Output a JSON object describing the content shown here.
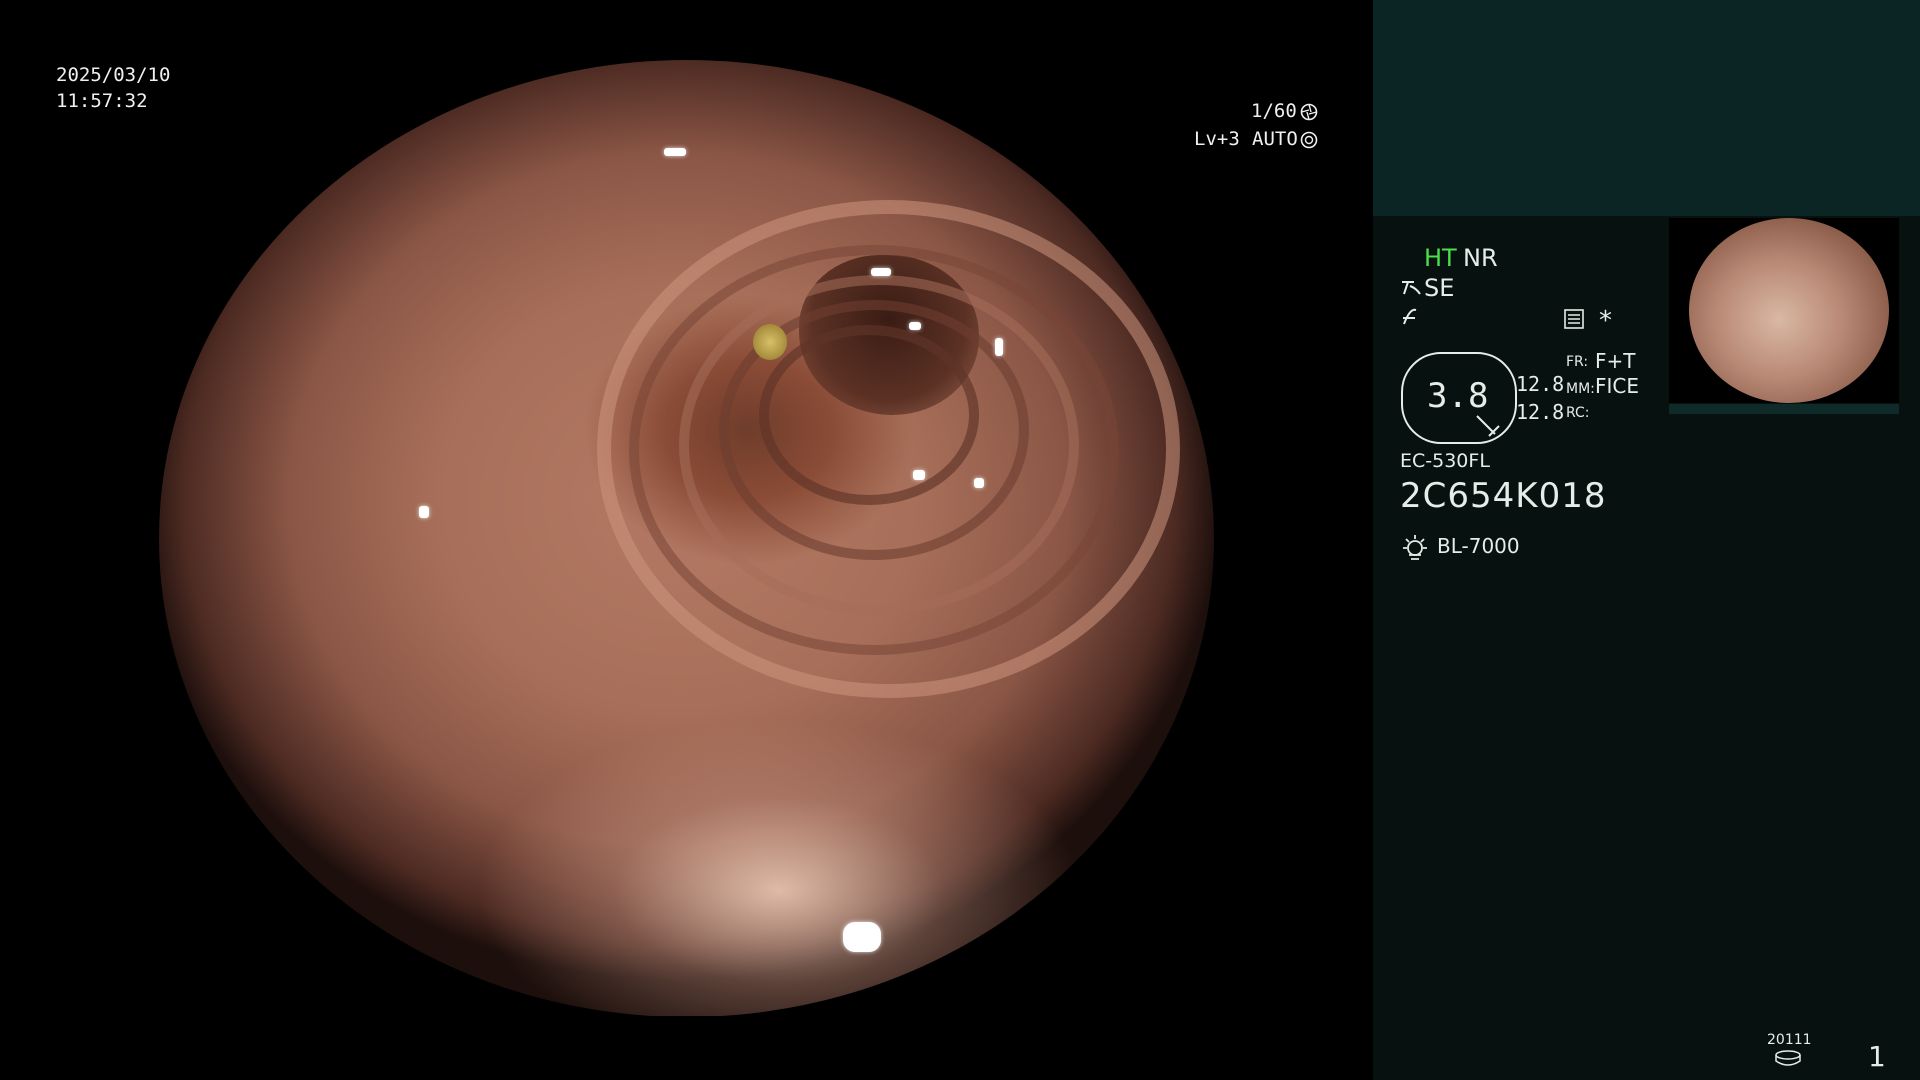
{
  "overlay": {
    "date": "2025/03/10",
    "time": "11:57:32",
    "shutter": "1/60",
    "level": "Lv+3",
    "exposure": "AUTO"
  },
  "panel": {
    "ht_label": "HT",
    "nr_label": "NR",
    "se_label": "SE",
    "mode_value": "3.8",
    "gain_top": "12.8",
    "gain_bottom": "12.8",
    "fr_label": "FR:",
    "fr_value": "F+T",
    "mm_label": "MM:",
    "mm_value": "FICE",
    "rc_label": "RC:",
    "scope_model": "EC-530FL",
    "scope_serial": "2C654K018",
    "light_source": "BL-7000",
    "asterisk": "*",
    "storage_count": "20111",
    "page_number": "1"
  },
  "icons": {
    "shutter_icon": "shutter-icon",
    "exposure_icon": "iris-icon",
    "structure_icon": "structure-enhance-icon",
    "color_icon": "color-enhance-icon",
    "record_icon": "record-icon",
    "light_icon": "light-source-icon",
    "storage_icon": "storage-disk-icon"
  },
  "colors": {
    "ht_green": "#4be04b",
    "panel_top": "#0b2524",
    "panel_bg": "#07110f"
  }
}
